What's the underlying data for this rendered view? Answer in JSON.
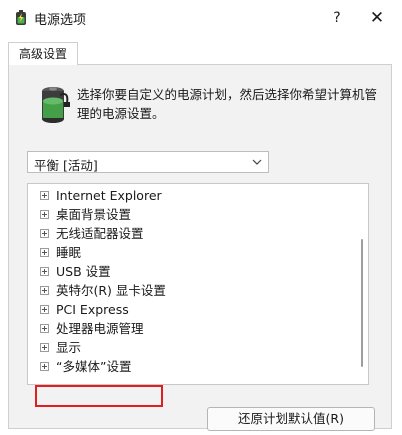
{
  "window": {
    "title": "电源选项",
    "help_label": "?",
    "close_label": "✕",
    "app_icon": "battery-power-icon"
  },
  "tabs": [
    {
      "label": "高级设置",
      "selected": true
    }
  ],
  "description": "选择你要自定义的电源计划，然后选择你希望计算机管理的电源设置。",
  "plan_select": {
    "value": "平衡 [活动]"
  },
  "tree_items": [
    {
      "label": "Internet Explorer"
    },
    {
      "label": "桌面背景设置"
    },
    {
      "label": "无线适配器设置"
    },
    {
      "label": "睡眠"
    },
    {
      "label": "USB 设置"
    },
    {
      "label": "英特尔(R) 显卡设置"
    },
    {
      "label": "PCI Express"
    },
    {
      "label": "处理器电源管理",
      "highlighted": true
    },
    {
      "label": "显示"
    },
    {
      "label": "“多媒体”设置"
    }
  ],
  "restore_button": "还原计划默认值(R)",
  "colors": {
    "highlight": "#e02020",
    "panel_bg": "#f2f2f2"
  }
}
